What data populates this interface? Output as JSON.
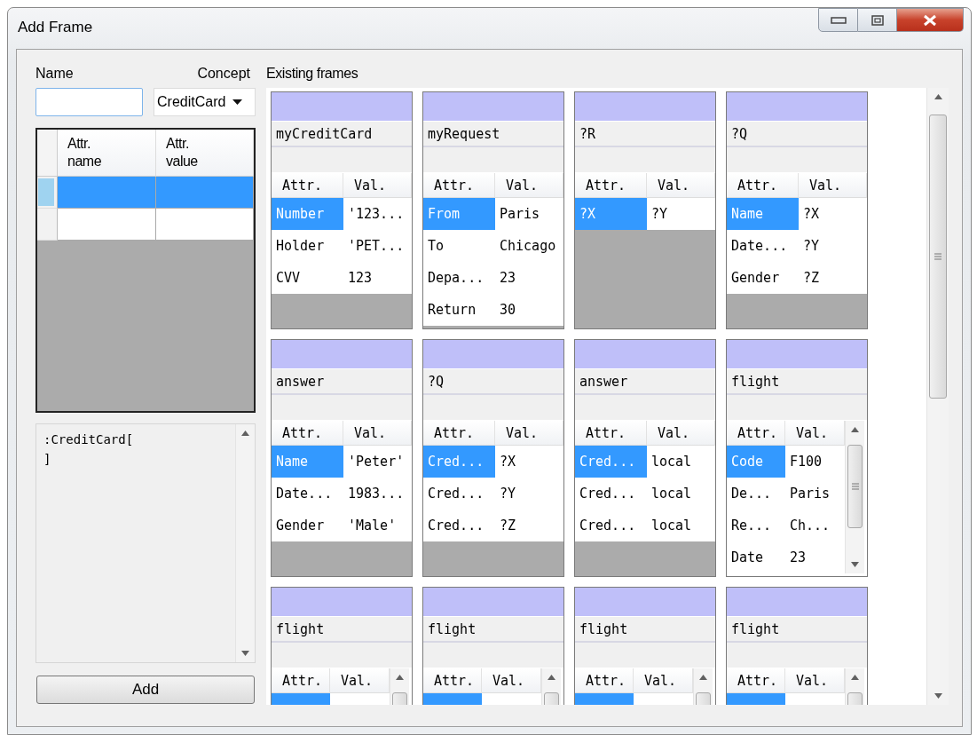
{
  "window": {
    "title": "Add Frame"
  },
  "form": {
    "name_label": "Name",
    "concept_label": "Concept",
    "concept_value": "CreditCard"
  },
  "attributes_grid": {
    "columns": [
      "Attr.\nname",
      "Attr.\nvalue"
    ],
    "rows": [
      {
        "selected": true
      },
      {
        "selected": false
      }
    ]
  },
  "preview_text": ":CreditCard[\n]",
  "add_button": "Add",
  "existing_frames": {
    "label": "Existing frames",
    "frames": [
      {
        "name": "myCreditCard",
        "columns": [
          "Attr.",
          "Val."
        ],
        "scrollbar": false,
        "rows": [
          {
            "attr": "Number",
            "val": "'123...",
            "selected": true
          },
          {
            "attr": "Holder",
            "val": "'PET...",
            "selected": false
          },
          {
            "attr": "CVV",
            "val": "123",
            "selected": false
          }
        ]
      },
      {
        "name": "myRequest",
        "columns": [
          "Attr.",
          "Val."
        ],
        "scrollbar": false,
        "rows": [
          {
            "attr": "From",
            "val": "Paris",
            "selected": true
          },
          {
            "attr": "To",
            "val": "Chicago",
            "selected": false
          },
          {
            "attr": "Depa...",
            "val": "23",
            "selected": false
          },
          {
            "attr": "Return",
            "val": "30",
            "selected": false
          }
        ]
      },
      {
        "name": "?R",
        "columns": [
          "Attr.",
          "Val."
        ],
        "scrollbar": false,
        "rows": [
          {
            "attr": "?X",
            "val": "?Y",
            "selected": true
          }
        ]
      },
      {
        "name": "?Q",
        "columns": [
          "Attr.",
          "Val."
        ],
        "scrollbar": false,
        "rows": [
          {
            "attr": "Name",
            "val": "?X",
            "selected": true
          },
          {
            "attr": "Date...",
            "val": "?Y",
            "selected": false
          },
          {
            "attr": "Gender",
            "val": "?Z",
            "selected": false
          }
        ]
      },
      {
        "name": "answer",
        "columns": [
          "Attr.",
          "Val."
        ],
        "scrollbar": false,
        "rows": [
          {
            "attr": "Name",
            "val": "'Peter'",
            "selected": true
          },
          {
            "attr": "Date...",
            "val": "1983...",
            "selected": false
          },
          {
            "attr": "Gender",
            "val": "'Male'",
            "selected": false
          }
        ]
      },
      {
        "name": "?Q",
        "columns": [
          "Attr.",
          "Val."
        ],
        "scrollbar": false,
        "rows": [
          {
            "attr": "Cred...",
            "val": "?X",
            "selected": true
          },
          {
            "attr": "Cred...",
            "val": "?Y",
            "selected": false
          },
          {
            "attr": "Cred...",
            "val": "?Z",
            "selected": false
          }
        ]
      },
      {
        "name": "answer",
        "columns": [
          "Attr.",
          "Val."
        ],
        "scrollbar": false,
        "rows": [
          {
            "attr": "Cred...",
            "val": "local",
            "selected": true
          },
          {
            "attr": "Cred...",
            "val": "local",
            "selected": false
          },
          {
            "attr": "Cred...",
            "val": "local",
            "selected": false
          }
        ]
      },
      {
        "name": "flight",
        "columns": [
          "Attr.",
          "Val."
        ],
        "scrollbar": true,
        "rows": [
          {
            "attr": "Code",
            "val": "F100",
            "selected": true
          },
          {
            "attr": "De...",
            "val": "Paris",
            "selected": false
          },
          {
            "attr": "Re...",
            "val": "Ch...",
            "selected": false
          },
          {
            "attr": "Date",
            "val": "23",
            "selected": false
          }
        ]
      },
      {
        "name": "flight",
        "columns": [
          "Attr.",
          "Val."
        ],
        "scrollbar": true,
        "rows": [
          {
            "selected": true
          }
        ]
      },
      {
        "name": "flight",
        "columns": [
          "Attr.",
          "Val."
        ],
        "scrollbar": true,
        "rows": [
          {
            "selected": true
          }
        ]
      },
      {
        "name": "flight",
        "columns": [
          "Attr.",
          "Val."
        ],
        "scrollbar": true,
        "rows": [
          {
            "selected": true
          }
        ]
      },
      {
        "name": "flight",
        "columns": [
          "Attr.",
          "Val."
        ],
        "scrollbar": true,
        "rows": [
          {
            "selected": true
          }
        ]
      }
    ]
  }
}
